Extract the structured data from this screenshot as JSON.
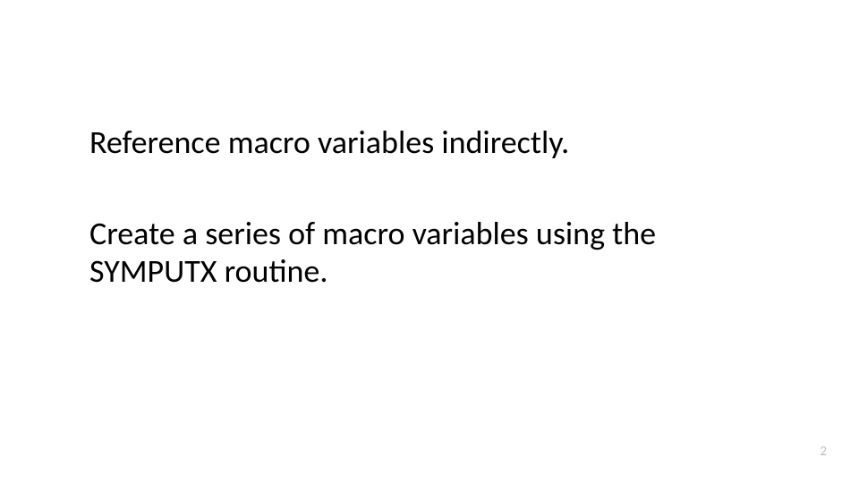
{
  "content": {
    "paragraph1": "Reference macro variables indirectly.",
    "paragraph2": "Create a series of macro variables using the SYMPUTX routine."
  },
  "footer": {
    "page_number": "2"
  }
}
